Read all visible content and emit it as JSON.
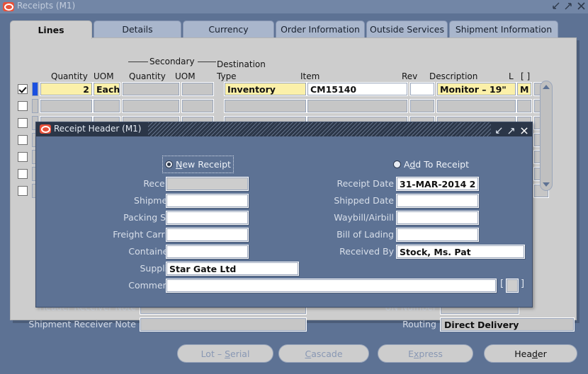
{
  "window": {
    "title": "Receipts (M1)",
    "icon": "oracle-forms-icon",
    "controls": {
      "minimize": "minimize-icon",
      "maximize": "maximize-icon",
      "close": "close-icon"
    }
  },
  "tabs": [
    {
      "label": "Lines",
      "active": true
    },
    {
      "label": "Details",
      "active": false
    },
    {
      "label": "Currency",
      "active": false
    },
    {
      "label": "Order Information",
      "active": false
    },
    {
      "label": "Outside Services",
      "active": false
    },
    {
      "label": "Shipment Information",
      "active": false
    }
  ],
  "grid": {
    "group_header": "Secondary",
    "headers": {
      "quantity": "Quantity",
      "uom": "UOM",
      "sec_quantity": "Quantity",
      "sec_uom": "UOM",
      "destination": "Destination",
      "destination_type": "Type",
      "item": "Item",
      "rev": "Rev",
      "description": "Description",
      "l": "L",
      "brackets": "[ ]"
    },
    "rows": [
      {
        "selected": true,
        "quantity": "2",
        "uom": "Each",
        "sec_quantity": "",
        "sec_uom": "",
        "destination_type": "Inventory",
        "item": "CM15140",
        "rev": "",
        "description": "Monitor – 19\"",
        "l": "M"
      },
      {
        "selected": false,
        "quantity": "",
        "uom": "",
        "sec_quantity": "",
        "sec_uom": "",
        "destination_type": "",
        "item": "",
        "rev": "",
        "description": "",
        "l": ""
      },
      {
        "selected": false,
        "quantity": "",
        "uom": "",
        "sec_quantity": "",
        "sec_uom": "",
        "destination_type": "",
        "item": "",
        "rev": "",
        "description": "",
        "l": ""
      },
      {
        "selected": false,
        "quantity": "",
        "uom": "",
        "sec_quantity": "",
        "sec_uom": "",
        "destination_type": "",
        "item": "",
        "rev": "",
        "description": "",
        "l": ""
      },
      {
        "selected": false,
        "quantity": "",
        "uom": "",
        "sec_quantity": "",
        "sec_uom": "",
        "destination_type": "",
        "item": "",
        "rev": "",
        "description": "",
        "l": ""
      },
      {
        "selected": false,
        "quantity": "",
        "uom": "",
        "sec_quantity": "",
        "sec_uom": "",
        "destination_type": "",
        "item": "",
        "rev": "",
        "description": "",
        "l": ""
      },
      {
        "selected": false,
        "quantity": "",
        "uom": "",
        "sec_quantity": "",
        "sec_uom": "",
        "destination_type": "",
        "item": "",
        "rev": "",
        "description": "",
        "l": ""
      }
    ],
    "scrollbar": {
      "up": "scroll-up-arrow-icon",
      "down": "scroll-down-arrow-icon"
    }
  },
  "notes": {
    "header_receiver_note_label": "Header Receiver Note",
    "header_receiver_note_value": "",
    "shipment_receiver_note_label": "Shipment Receiver Note",
    "shipment_receiver_note_value": "",
    "un_number_label": "UN Number",
    "un_number_value": "",
    "routing_label": "Routing",
    "routing_value": "Direct Delivery"
  },
  "buttons": [
    {
      "label": "Lot – Serial",
      "accel": "S",
      "disabled": true
    },
    {
      "label": "Cascade",
      "accel": "C",
      "disabled": true
    },
    {
      "label": "Express",
      "accel": "x",
      "disabled": true
    },
    {
      "label": "Header",
      "accel": "d",
      "disabled": false
    }
  ],
  "dialog": {
    "title": "Receipt Header (M1)",
    "icon": "oracle-forms-icon",
    "controls": {
      "minimize": "minimize-icon",
      "maximize": "maximize-icon",
      "close": "close-icon"
    },
    "radios": [
      {
        "label": "New Receipt",
        "accel": "N",
        "selected": true,
        "focused": true
      },
      {
        "label": "Add To Receipt",
        "accel": "d",
        "selected": false,
        "focused": false
      }
    ],
    "left_fields": [
      {
        "label": "Receipt",
        "value": "",
        "disabled": true
      },
      {
        "label": "Shipment",
        "value": "",
        "disabled": false
      },
      {
        "label": "Packing Slip",
        "value": "",
        "disabled": false
      },
      {
        "label": "Freight Carrier",
        "value": "",
        "disabled": false
      },
      {
        "label": "Containers",
        "value": "",
        "disabled": false
      },
      {
        "label": "Supplier",
        "value": "Star Gate Ltd",
        "disabled": false
      },
      {
        "label": "Comments",
        "value": "",
        "disabled": false
      }
    ],
    "right_fields": [
      {
        "label": "Receipt Date",
        "value": "31-MAR-2014 2",
        "disabled": false
      },
      {
        "label": "Shipped Date",
        "value": "",
        "disabled": false
      },
      {
        "label": "Waybill/Airbill",
        "value": "",
        "disabled": false
      },
      {
        "label": "Bill of Lading",
        "value": "",
        "disabled": false
      },
      {
        "label": "Received By",
        "value": "Stock, Ms. Pat",
        "disabled": false
      }
    ],
    "comments_lov": {
      "open_bracket": "[",
      "close_bracket": "]",
      "button": "lov-button"
    }
  },
  "colors": {
    "desktop": "#5d7294",
    "panel": "#cdcdcd",
    "title_bar": "#7286a6",
    "dialog_title_bar": "#2b3648",
    "accent_yellow": "#fbf0a9",
    "select_blue": "#1a4fe0",
    "icon_red": "#e8513a"
  }
}
